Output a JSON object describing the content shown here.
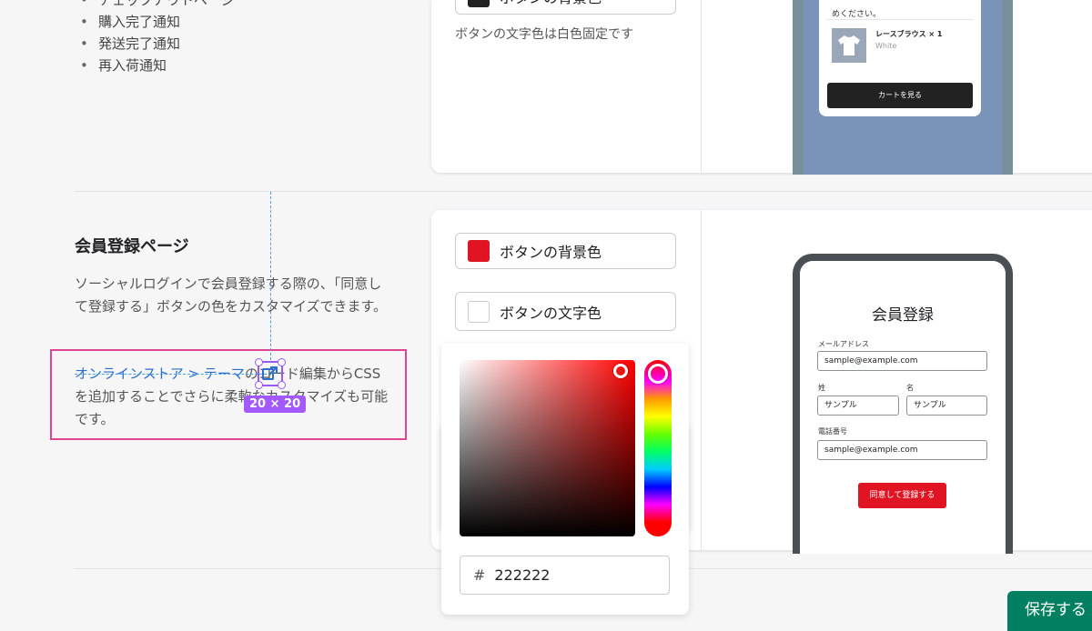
{
  "top_section": {
    "bullets": [
      "チェックアウトページ",
      "購入完了通知",
      "発送完了通知",
      "再入荷通知"
    ],
    "button_bg_label": "ボタンの背景色",
    "note": "ボタンの文字色は白色固定です",
    "preview": {
      "sheet_text": "めください。",
      "product_name": "レースブラウス × 1",
      "product_variant": "White",
      "cart_button": "カートを見る"
    }
  },
  "member_section": {
    "title": "会員登録ページ",
    "description": "ソーシャルログインで会員登録する際の、「同意して登録する」ボタンの色をカスタマイズできます。",
    "link_text": "オンラインストア > テーマ",
    "link_suffix": "のコード編集からCSSを追加することでさらに柔軟なカスタマイズも可能です。",
    "bg_color_label": "ボタンの背景色",
    "text_color_label": "ボタンの文字色",
    "bg_color": "#e01423",
    "text_color": "#ffffff",
    "preview": {
      "title": "会員登録",
      "email_label": "メールアドレス",
      "email_value": "sample@example.com",
      "last_name_label": "姓",
      "last_name_value": "サンプル",
      "first_name_label": "名",
      "first_name_value": "サンプル",
      "phone_label": "電話番号",
      "phone_value": "sample@example.com",
      "submit_label": "同意して登録する"
    }
  },
  "color_picker": {
    "hash": "#",
    "hex_value": "222222"
  },
  "overlay": {
    "dimension_badge": "20 × 20"
  },
  "footer": {
    "save_label": "保存する"
  }
}
